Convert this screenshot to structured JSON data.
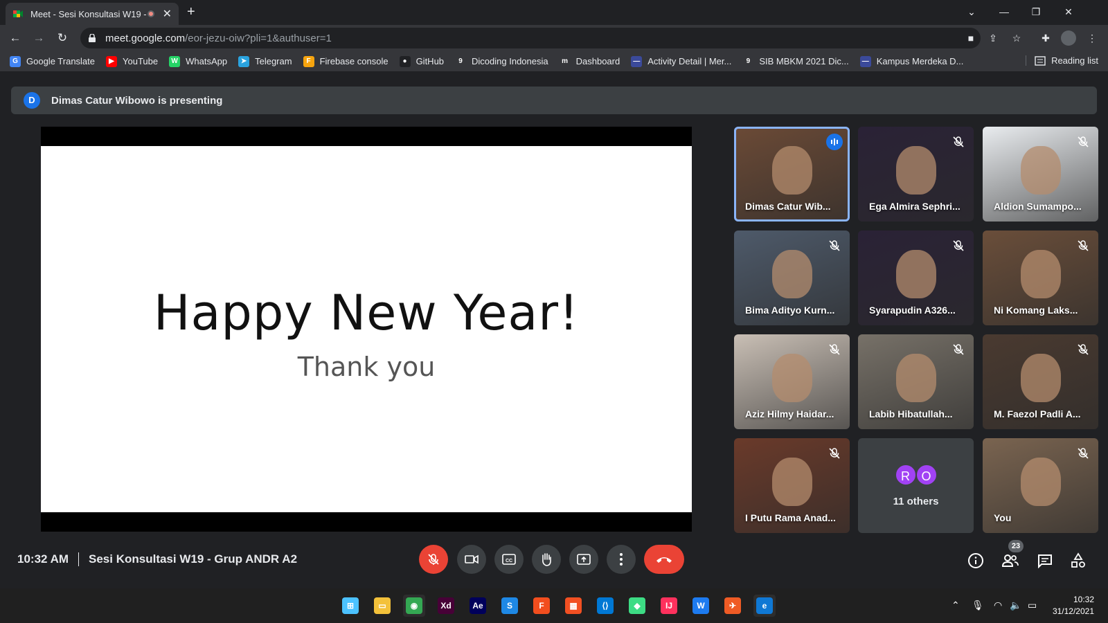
{
  "browser": {
    "tab_title": "Meet - Sesi Konsultasi W19 -",
    "url_host": "meet.google.com",
    "url_path": "/eor-jezu-oiw?pli=1&authuser=1",
    "reading_list": "Reading list",
    "bookmarks": [
      {
        "label": "Google Translate",
        "icon": "google-translate-icon",
        "color": "#4285f4",
        "glyph": "G"
      },
      {
        "label": "YouTube",
        "icon": "youtube-icon",
        "color": "#ff0000",
        "glyph": "▶"
      },
      {
        "label": "WhatsApp",
        "icon": "whatsapp-icon",
        "color": "#25d366",
        "glyph": "W"
      },
      {
        "label": "Telegram",
        "icon": "telegram-icon",
        "color": "#2aa3df",
        "glyph": "➤"
      },
      {
        "label": "Firebase console",
        "icon": "firebase-icon",
        "color": "#f6a40e",
        "glyph": "F"
      },
      {
        "label": "GitHub",
        "icon": "github-icon",
        "color": "#202124",
        "glyph": "●"
      },
      {
        "label": "Dicoding Indonesia",
        "icon": "dicoding-icon",
        "color": "#35363a",
        "glyph": "9"
      },
      {
        "label": "Dashboard",
        "icon": "dashboard-icon",
        "color": "#35363a",
        "glyph": "m"
      },
      {
        "label": "Activity Detail | Mer...",
        "icon": "merdeka-icon",
        "color": "#3b4a9a",
        "glyph": "—"
      },
      {
        "label": "SIB MBKM 2021 Dic...",
        "icon": "dicoding-icon",
        "color": "#35363a",
        "glyph": "9"
      },
      {
        "label": "Kampus Merdeka D...",
        "icon": "merdeka-icon",
        "color": "#3b4a9a",
        "glyph": "—"
      }
    ]
  },
  "meet": {
    "presenter_initial": "D",
    "presenting_text": "Dimas Catur Wibowo is presenting",
    "slide": {
      "title": "Happy New Year!",
      "subtitle": "Thank you"
    },
    "participants": [
      {
        "name": "Dimas Catur Wib...",
        "bg": "#6b4a36",
        "active": true
      },
      {
        "name": "Ega Almira Sephri...",
        "bg": "#2a2236"
      },
      {
        "name": "Aldion Sumampo...",
        "bg": "#e9ecef"
      },
      {
        "name": "Bima Adityo Kurn...",
        "bg": "#4e5a6a"
      },
      {
        "name": "Syarapudin A326...",
        "bg": "#2a2236"
      },
      {
        "name": "Ni Komang Laks...",
        "bg": "#6a4e3a"
      },
      {
        "name": "Aziz Hilmy Haidar...",
        "bg": "#c9bfb5"
      },
      {
        "name": "Labib Hibatullah...",
        "bg": "#777168"
      },
      {
        "name": "M. Faezol Padli A...",
        "bg": "#4a3a30"
      },
      {
        "name": "I Putu Rama Anad...",
        "bg": "#6a3a2a"
      },
      {
        "name": "You",
        "bg": "#7a6450"
      }
    ],
    "others": {
      "avatars": [
        "R",
        "O"
      ],
      "label": "11 others"
    },
    "time": "10:32 AM",
    "meeting_name": "Sesi Konsultasi W19 - Grup ANDR A2",
    "people_count": "23",
    "colors": {
      "end_call": "#ea4335",
      "accent": "#8ab4f8"
    }
  },
  "taskbar": {
    "time": "10:32",
    "date": "31/12/2021",
    "apps": [
      "start-icon",
      "file-explorer-icon",
      "chrome-icon",
      "adobe-xd-icon",
      "after-effects-icon",
      "sketch-like-icon",
      "figma-icon",
      "microsoft-store-icon",
      "vscode-icon",
      "android-studio-icon",
      "intellij-icon",
      "webstorm-icon",
      "postman-icon",
      "edge-icon"
    ]
  }
}
